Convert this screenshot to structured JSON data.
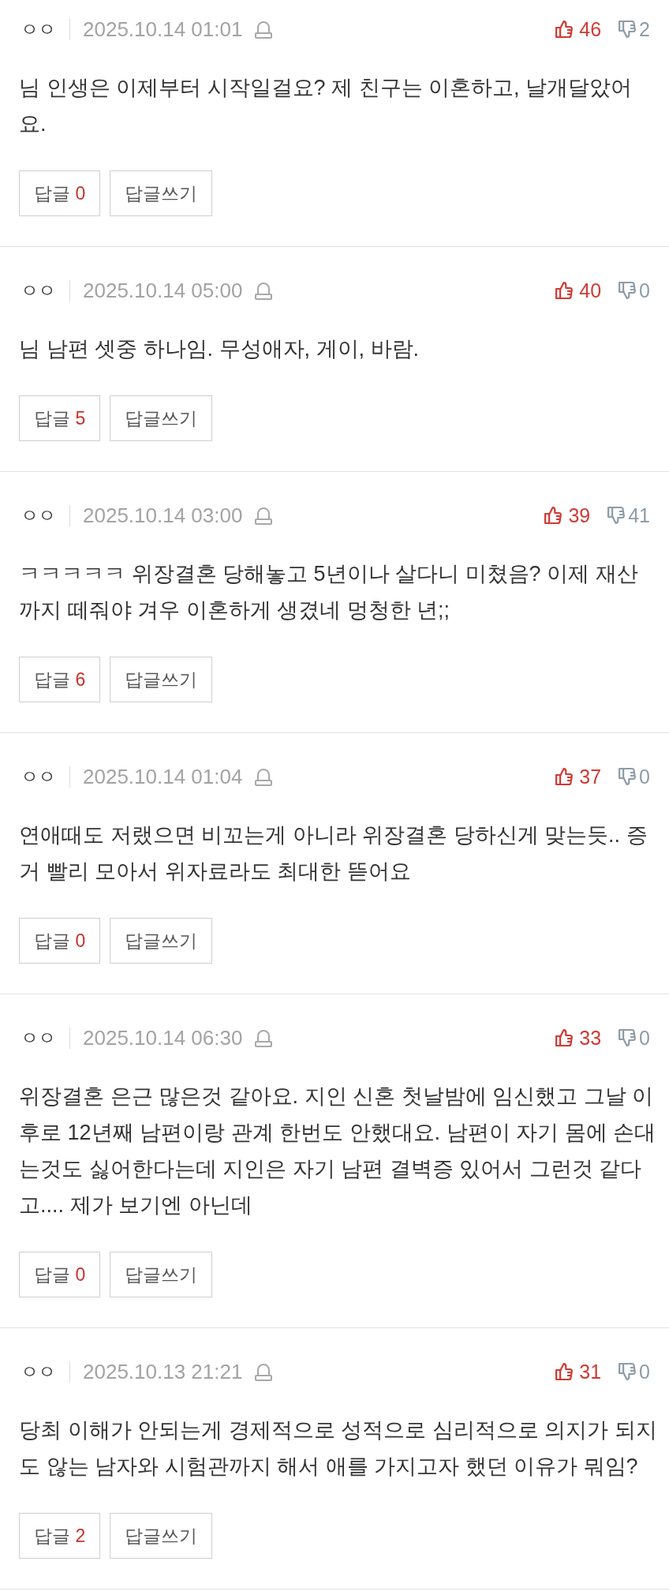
{
  "comments": [
    {
      "author": "ㅇㅇ",
      "date": "2025.10.14 01:01",
      "likes": "46",
      "dislikes": "2",
      "text": "님 인생은 이제부터 시작일걸요? 제 친구는 이혼하고, 날개달았어요.",
      "reply_label": "답글",
      "reply_count": "0",
      "write_reply": "답글쓰기"
    },
    {
      "author": "ㅇㅇ",
      "date": "2025.10.14 05:00",
      "likes": "40",
      "dislikes": "0",
      "text": "님 남편 셋중 하나임. 무성애자, 게이, 바람.",
      "reply_label": "답글",
      "reply_count": "5",
      "write_reply": "답글쓰기"
    },
    {
      "author": "ㅇㅇ",
      "date": "2025.10.14 03:00",
      "likes": "39",
      "dislikes": "41",
      "text": "ㅋㅋㅋㅋㅋ 위장결혼 당해놓고 5년이나 살다니 미쳤음? 이제 재산까지 떼줘야 겨우 이혼하게 생겼네 멍청한 년;;",
      "reply_label": "답글",
      "reply_count": "6",
      "write_reply": "답글쓰기"
    },
    {
      "author": "ㅇㅇ",
      "date": "2025.10.14 01:04",
      "likes": "37",
      "dislikes": "0",
      "text": "연애때도 저랬으면 비꼬는게 아니라 위장결혼 당하신게 맞는듯.. 증거 빨리 모아서 위자료라도 최대한 뜯어요",
      "reply_label": "답글",
      "reply_count": "0",
      "write_reply": "답글쓰기"
    },
    {
      "author": "ㅇㅇ",
      "date": "2025.10.14 06:30",
      "likes": "33",
      "dislikes": "0",
      "text": "위장결혼 은근 많은것 같아요. 지인 신혼 첫날밤에 임신했고 그날 이후로 12년째 남편이랑 관계 한번도 안했대요. 남편이 자기 몸에 손대는것도 싫어한다는데 지인은 자기 남편 결벽증 있어서 그런것 같다고.... 제가 보기엔 아닌데",
      "reply_label": "답글",
      "reply_count": "0",
      "write_reply": "답글쓰기"
    },
    {
      "author": "ㅇㅇ",
      "date": "2025.10.13 21:21",
      "likes": "31",
      "dislikes": "0",
      "text": "당최 이해가 안되는게 경제적으로 성적으로 심리적으로 의지가 되지도 않는 남자와 시험관까지 해서 애를 가지고자 했던 이유가 뭐임?",
      "reply_label": "답글",
      "reply_count": "2",
      "write_reply": "답글쓰기"
    }
  ]
}
